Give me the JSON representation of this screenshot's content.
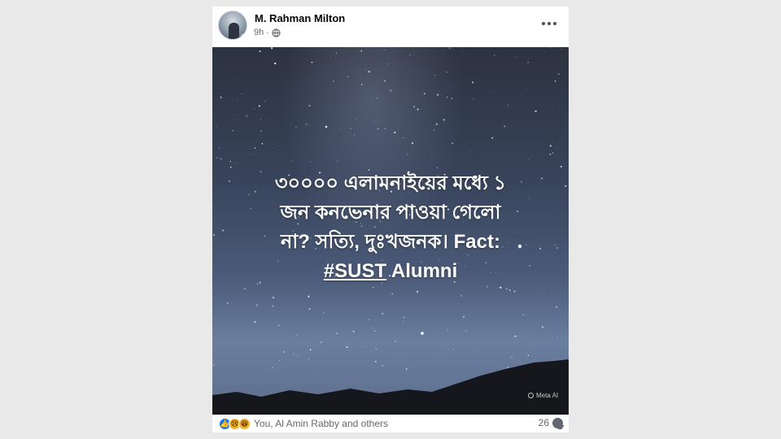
{
  "post": {
    "author": "M. Rahman Milton",
    "time": "9h",
    "separator": "·",
    "privacy_icon": "globe-icon",
    "more_icon": "more-options-icon",
    "image": {
      "text_line1": "৩০০০০ এলামনাইয়ের মধ্যে ১",
      "text_line2": "জন কনভেনার পাওয়া গেলো",
      "text_line3": "না? সত্যি, দুঃখজনক। Fact:",
      "hashtag": "#SUST",
      "text_after_hashtag": " Alumni",
      "watermark": "Meta AI"
    },
    "reactions": {
      "icons": [
        "like-icon",
        "sad-icon",
        "haha-icon"
      ],
      "summary": "You, Al Amin Rabby and others"
    },
    "comment_count": "26"
  },
  "colors": {
    "page_bg": "#e9e9e9",
    "card_bg": "#ffffff",
    "like_blue": "#1877f2",
    "meta_gray": "#65676b"
  }
}
